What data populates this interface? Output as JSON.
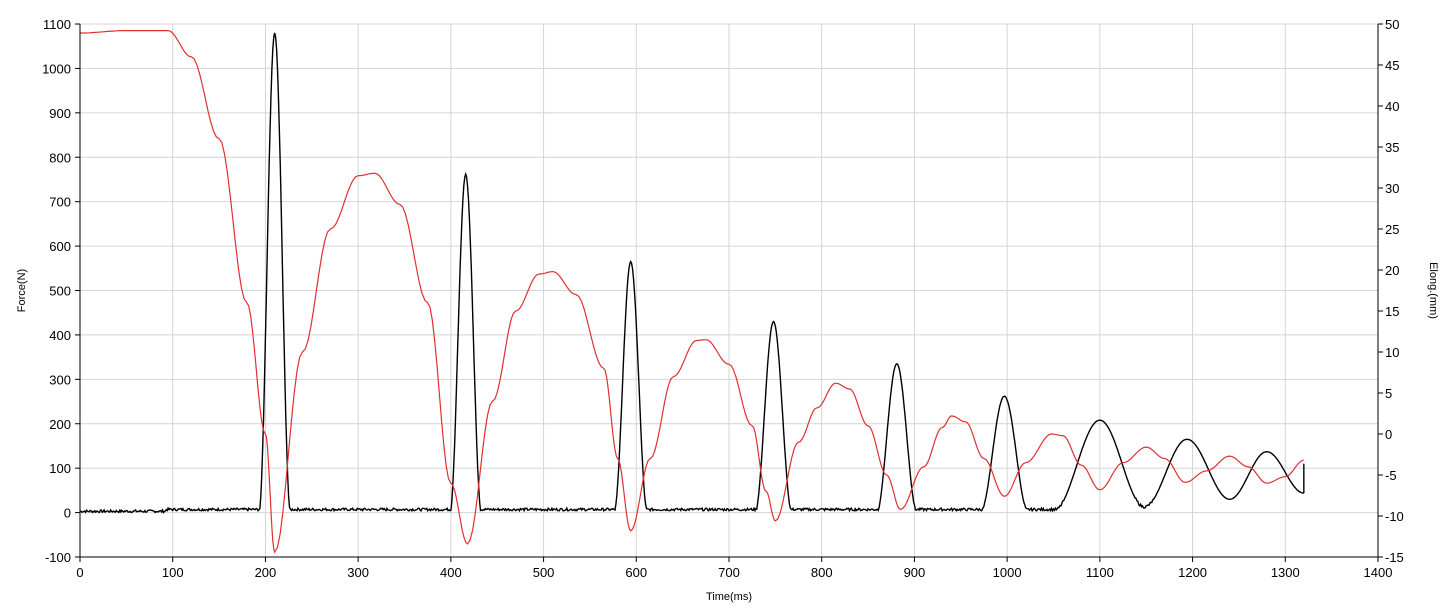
{
  "chart_data": {
    "type": "line",
    "xlabel": "Time(ms)",
    "ylabel": "Force(N)",
    "y2label": "Elong.(mm)",
    "xlim": [
      0,
      1400
    ],
    "ylim": [
      -100,
      1100
    ],
    "y2lim": [
      -15,
      50
    ],
    "xticks": [
      0,
      100,
      200,
      300,
      400,
      500,
      600,
      700,
      800,
      900,
      1000,
      1100,
      1200,
      1300,
      1400
    ],
    "yticks": [
      -100,
      0,
      100,
      200,
      300,
      400,
      500,
      600,
      700,
      800,
      900,
      1000,
      1100
    ],
    "y2ticks": [
      -15,
      -10,
      -5,
      0,
      5,
      10,
      15,
      20,
      25,
      30,
      35,
      40,
      45,
      50
    ],
    "grid": true,
    "series": [
      {
        "axis": "left",
        "color": "#000000",
        "peaks": [
          {
            "t": 210,
            "value": 1080,
            "halfwidth": 17
          },
          {
            "t": 416,
            "value": 762,
            "halfwidth": 17
          },
          {
            "t": 594,
            "value": 565,
            "halfwidth": 18
          },
          {
            "t": 748,
            "value": 430,
            "halfwidth": 20
          },
          {
            "t": 881,
            "value": 335,
            "halfwidth": 22
          },
          {
            "t": 997,
            "value": 262,
            "halfwidth": 26
          },
          {
            "t": 1100,
            "value": 208,
            "halfwidth": 33
          },
          {
            "t": 1194,
            "value": 165,
            "halfwidth": 40
          },
          {
            "t": 1280,
            "value": 137,
            "halfwidth": 45
          }
        ],
        "troughs": [
          {
            "t": 1148,
            "value": 13
          },
          {
            "t": 1240,
            "value": 30
          }
        ],
        "baseline": 3,
        "end": {
          "t": 1320,
          "value": 44
        }
      },
      {
        "axis": "right",
        "color": "#e03030",
        "points": [
          [
            0,
            48.9
          ],
          [
            50,
            49.2
          ],
          [
            95,
            49.2
          ],
          [
            120,
            46
          ],
          [
            150,
            36
          ],
          [
            180,
            16
          ],
          [
            200,
            0
          ],
          [
            210,
            -14.4
          ],
          [
            240,
            10
          ],
          [
            270,
            25
          ],
          [
            300,
            31.5
          ],
          [
            318,
            31.8
          ],
          [
            345,
            28
          ],
          [
            375,
            16
          ],
          [
            400,
            -6
          ],
          [
            418,
            -13.4
          ],
          [
            445,
            4
          ],
          [
            470,
            15
          ],
          [
            495,
            19.5
          ],
          [
            510,
            19.8
          ],
          [
            535,
            17
          ],
          [
            565,
            8
          ],
          [
            580,
            -3
          ],
          [
            594,
            -11.8
          ],
          [
            615,
            -3
          ],
          [
            640,
            7
          ],
          [
            665,
            11.4
          ],
          [
            675,
            11.5
          ],
          [
            700,
            8.5
          ],
          [
            725,
            1
          ],
          [
            740,
            -7
          ],
          [
            750,
            -10.6
          ],
          [
            775,
            -1
          ],
          [
            795,
            3.2
          ],
          [
            815,
            6.2
          ],
          [
            830,
            5.5
          ],
          [
            850,
            1
          ],
          [
            870,
            -5
          ],
          [
            885,
            -9.2
          ],
          [
            910,
            -4
          ],
          [
            930,
            0.8
          ],
          [
            940,
            2.2
          ],
          [
            955,
            1.5
          ],
          [
            975,
            -3
          ],
          [
            997,
            -7.6
          ],
          [
            1020,
            -3.5
          ],
          [
            1048,
            0
          ],
          [
            1060,
            -0.2
          ],
          [
            1080,
            -3.8
          ],
          [
            1100,
            -6.8
          ],
          [
            1125,
            -3.5
          ],
          [
            1150,
            -1.6
          ],
          [
            1170,
            -3
          ],
          [
            1192,
            -5.9
          ],
          [
            1215,
            -4.5
          ],
          [
            1240,
            -2.7
          ],
          [
            1260,
            -4
          ],
          [
            1280,
            -6
          ],
          [
            1300,
            -5.2
          ],
          [
            1320,
            -3.2
          ]
        ]
      }
    ]
  }
}
